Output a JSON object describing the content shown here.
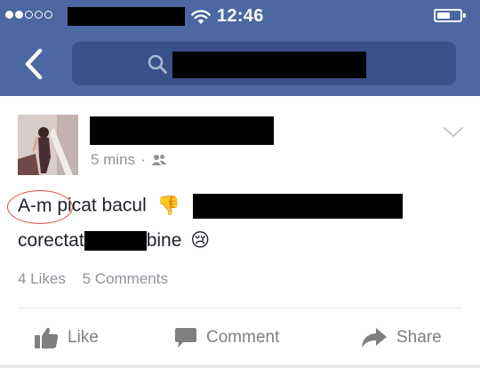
{
  "status_bar": {
    "time": "12:46",
    "signal_full": 2,
    "signal_total": 5,
    "battery_level": 0.5
  },
  "nav": {
    "back_icon": "chevron-left-icon",
    "search_icon": "search-icon"
  },
  "post": {
    "timestamp": "5 mins",
    "separator": "·",
    "audience_icon": "friends-icon",
    "text": {
      "circled_word": "A-m",
      "line1_rest": "picat bacul",
      "line2_start": "corectat",
      "line2_end": "bine"
    },
    "emoji": {
      "thumbs_down": "👎",
      "crying": "😢"
    },
    "likes": "4 Likes",
    "comments": "5 Comments"
  },
  "actions": {
    "like": "Like",
    "comment": "Comment",
    "share": "Share"
  },
  "colors": {
    "brand": "#4c67a1",
    "search_bg": "#3a5089",
    "muted": "#90949c",
    "action": "#7f7f7f",
    "circle": "#e0483c"
  }
}
